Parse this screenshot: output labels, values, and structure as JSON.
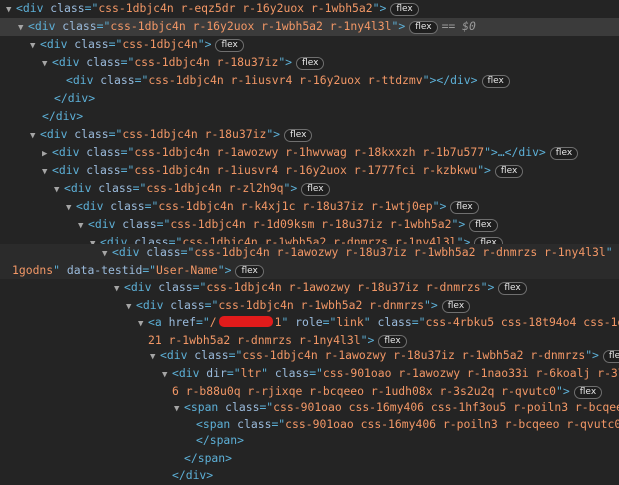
{
  "lines": {
    "l1": {
      "cls": "css-1dbjc4n r-eqz5dr r-16y2uox r-1wbh5a2"
    },
    "l2": {
      "cls": "css-1dbjc4n r-16y2uox r-1wbh5a2 r-1ny4l3l",
      "eq": "== $0"
    },
    "l3": {
      "cls": "css-1dbjc4n"
    },
    "l4": {
      "cls": "css-1dbjc4n r-18u37iz"
    },
    "l5": {
      "cls": "css-1dbjc4n r-1iusvr4 r-16y2uox r-ttdzmv"
    },
    "l6": {
      "close": "</div>"
    },
    "l7": {
      "close": "</div>"
    },
    "l8": {
      "cls": "css-1dbjc4n r-18u37iz"
    },
    "l9": {
      "cls": "css-1dbjc4n r-1awozwy r-1hwvwag r-18kxxzh r-1b7u577"
    },
    "l10": {
      "cls": "css-1dbjc4n r-1iusvr4 r-16y2uox r-1777fci r-kzbkwu"
    },
    "l11": {
      "cls": "css-1dbjc4n r-zl2h9q"
    },
    "l12": {
      "cls": "css-1dbjc4n r-k4xj1c r-18u37iz r-1wtj0ep"
    },
    "l13": {
      "cls": "css-1dbjc4n r-1d09ksm r-18u37iz r-1wbh5a2"
    },
    "l14": {
      "cls": "css-1dbjc4n r-1wbh5a2 r-dnmrzs r-1ny4l3l"
    },
    "l15": {
      "cls": "css-1dbjc4n r-1awozwy r-18u37iz r-1wbh5a2 r-dnmrzs r-1ny4l3l",
      "idcont": "1godns",
      "testid": "User-Name"
    },
    "l16": {
      "cls": "css-1dbjc4n r-1awozwy r-18u37iz r-dnmrzs"
    },
    "l17": {
      "cls": "css-1dbjc4n r-1wbh5a2 r-dnmrzs"
    },
    "l18": {
      "href_suffix": "1",
      "role": "link",
      "cls": "css-4rbku5 css-18t94o4 css-1dbjc4",
      "cont": "21 r-1wbh5a2 r-dnmrzs r-1ny4l3l"
    },
    "l19": {
      "cls": "css-1dbjc4n r-1awozwy r-18u37iz r-1wbh5a2 r-dnmrzs"
    },
    "l20": {
      "dir": "ltr",
      "cls": "css-901oao r-1awozwy r-1nao33i r-6koalj r-37j5",
      "cont": "6 r-b88u0q r-rjixqe r-bcqeeo r-1udh08x r-3s2u2q r-qvutc0"
    },
    "l21": {
      "cls": "css-901oao css-16my406 css-1hf3ou5 r-poiln3 r-bcqeeo"
    },
    "l22": {
      "cls": "css-901oao css-16my406 r-poiln3 r-bcqeeo r-qvutc0"
    },
    "l23": {
      "close": "</span>"
    },
    "l24": {
      "close": "</span>"
    },
    "l25": {
      "close": "</div>"
    }
  },
  "syntax": {
    "div": "div",
    "span": "span",
    "a": "a",
    "class": "class",
    "href": "href",
    "role": "role",
    "dir": "dir",
    "id": "id",
    "data_testid": "data-testid",
    "ellipsis": "…</div>"
  },
  "badge_label": "flex",
  "colors": {
    "background": "#242424",
    "selected_row": "#3b3b3b",
    "tag": "#5db0d7",
    "attr": "#9bbbdc",
    "value": "#f29766",
    "redaction": "#e21b1b"
  }
}
